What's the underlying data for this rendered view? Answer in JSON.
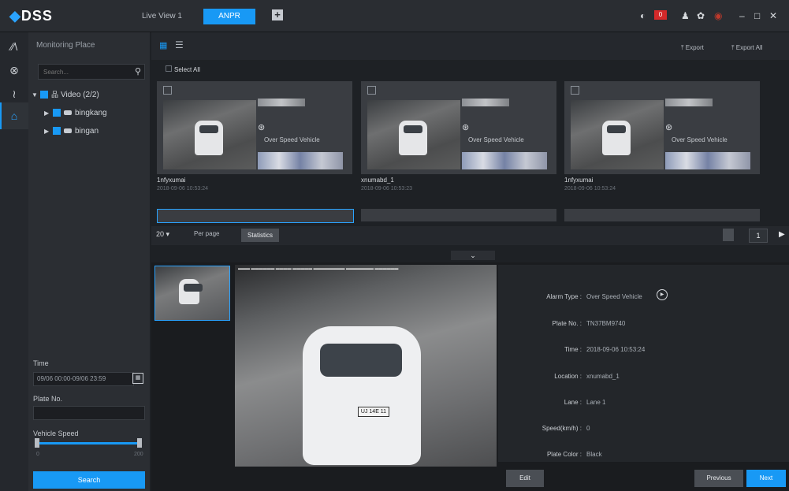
{
  "app": {
    "logo": "DSS",
    "tabs": [
      {
        "label": "Live View 1"
      },
      {
        "label": "ANPR"
      }
    ],
    "add_tab": "+"
  },
  "topbar": {
    "alarm_count": "0"
  },
  "sidebar": {
    "title": "Monitoring Place",
    "search_placeholder": "Search...",
    "tree": {
      "root": "Video (2/2)",
      "children": [
        {
          "label": "bingkang"
        },
        {
          "label": "bingan"
        }
      ]
    },
    "time_label": "Time",
    "time_value": "09/06 00:00-09/06 23:59",
    "plate_label": "Plate No.",
    "speed_label": "Vehicle Speed",
    "speed_min": "0",
    "speed_max": "200",
    "search_button": "Search"
  },
  "toolbar": {
    "export": "Export",
    "export_all": "Export All",
    "select_all": "Select All"
  },
  "cards": [
    {
      "name": "1nfyxumai",
      "time": "2018-09-06 10:53:24",
      "violation": "Over Speed Vehicle"
    },
    {
      "name": "xnumabd_1",
      "time": "2018-09-06 10:53:23",
      "violation": "Over Speed Vehicle"
    },
    {
      "name": "1nfyxumai",
      "time": "2018-09-06 10:53:24",
      "violation": "Over Speed Vehicle"
    }
  ],
  "pagination": {
    "per_page_value": "20",
    "per_page_label": "Per page",
    "statistics": "Statistics",
    "current_page": "1"
  },
  "detail": {
    "plate_overlay": "UJ 14E 11",
    "fields": [
      {
        "label": "Alarm Type :",
        "value": "Over Speed Vehicle"
      },
      {
        "label": "Plate No. :",
        "value": "TN37BM9740"
      },
      {
        "label": "Time :",
        "value": "2018-09-06 10:53:24"
      },
      {
        "label": "Location :",
        "value": "xnumabd_1"
      },
      {
        "label": "Lane :",
        "value": "Lane 1"
      },
      {
        "label": "Speed(km/h) :",
        "value": "0"
      },
      {
        "label": "Plate Color :",
        "value": "Black"
      }
    ],
    "edit": "Edit",
    "previous": "Previous",
    "next": "Next"
  }
}
